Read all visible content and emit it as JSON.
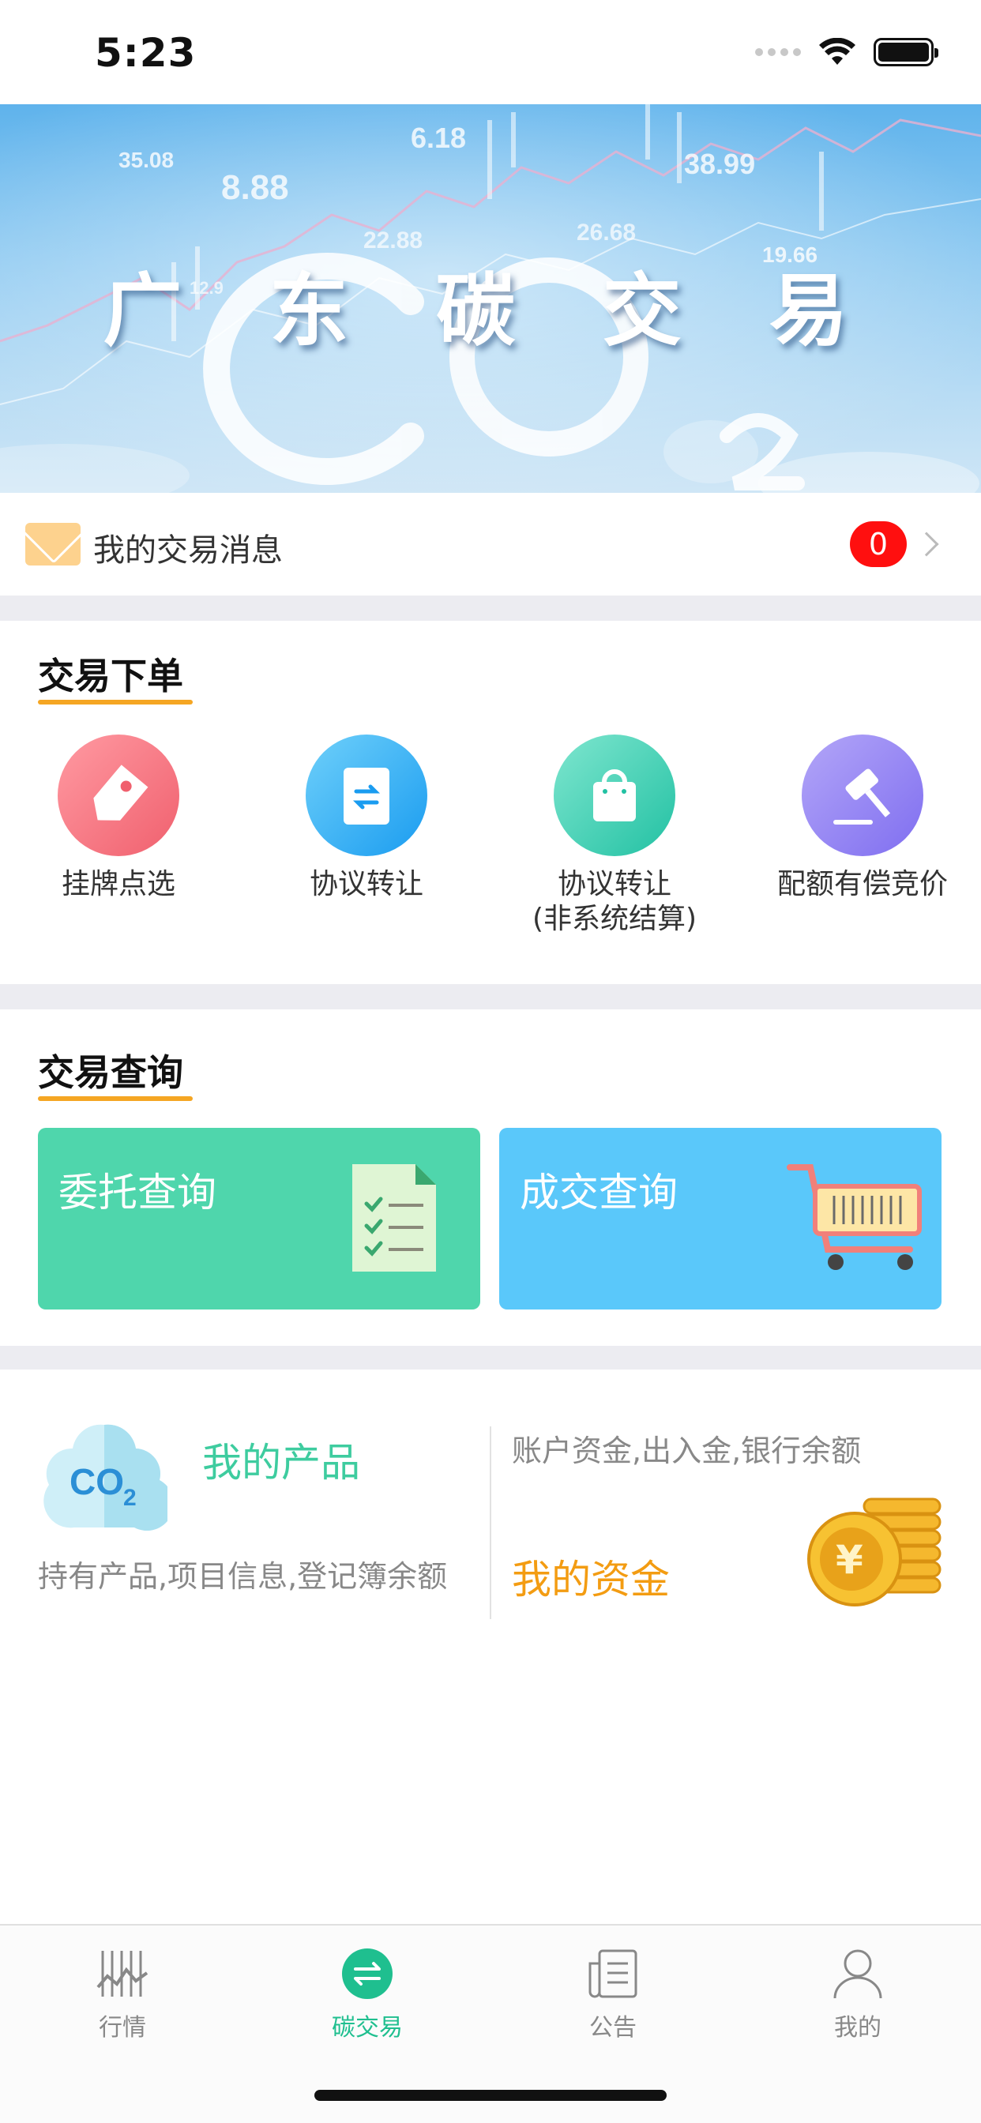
{
  "status_bar": {
    "time": "5:23"
  },
  "banner": {
    "title": "广 东 碳 交 易",
    "ticker_numbers": [
      "35.08",
      "8.88",
      "6.18",
      "38.99",
      "22.88",
      "26.68",
      "19.66",
      "12.9"
    ]
  },
  "messages": {
    "label": "我的交易消息",
    "count": "0"
  },
  "order_section": {
    "title": "交易下单",
    "items": [
      {
        "label": "挂牌点选",
        "icon": "tag-icon",
        "color": "#f46a78"
      },
      {
        "label": "协议转让",
        "icon": "swap-document-icon",
        "color": "#27aef0"
      },
      {
        "label": "协议转让",
        "sub_label": "(非系统结算)",
        "icon": "shopping-bag-icon",
        "color": "#3ccfb0"
      },
      {
        "label": "配额有偿竞价",
        "icon": "auction-hammer-icon",
        "color": "#8e7df0"
      }
    ]
  },
  "query_section": {
    "title": "交易查询",
    "cards": [
      {
        "label": "委托查询",
        "icon": "checklist-document-icon",
        "color": "#4fd6ac"
      },
      {
        "label": "成交查询",
        "icon": "shopping-cart-icon",
        "color": "#5ac8fa"
      }
    ]
  },
  "products": {
    "title": "我的产品",
    "description": "持有产品,项目信息,登记簿余额",
    "icon": "co2-cloud-icon"
  },
  "funds": {
    "description": "账户资金,出入金,银行余额",
    "title": "我的资金",
    "icon": "yuan-coins-icon"
  },
  "tabbar": {
    "tabs": [
      {
        "label": "行情",
        "icon": "market-chart-icon",
        "active": false
      },
      {
        "label": "碳交易",
        "icon": "exchange-arrows-icon",
        "active": true
      },
      {
        "label": "公告",
        "icon": "newspaper-icon",
        "active": false
      },
      {
        "label": "我的",
        "icon": "user-profile-icon",
        "active": false
      }
    ]
  },
  "colors": {
    "accent_green": "#1fbf8f",
    "underline_orange": "#f5a623",
    "badge_red": "#ff0f0f",
    "fund_orange": "#f39c12",
    "product_green": "#3ecc9f"
  }
}
